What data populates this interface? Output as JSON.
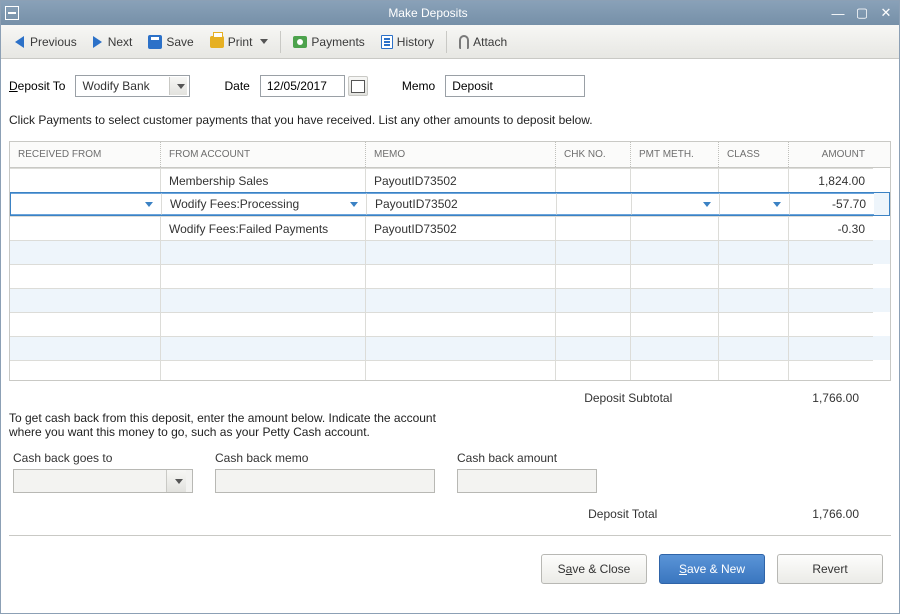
{
  "window": {
    "title": "Make Deposits"
  },
  "toolbar": {
    "previous": "Previous",
    "next": "Next",
    "save": "Save",
    "print": "Print",
    "payments": "Payments",
    "history": "History",
    "attach": "Attach"
  },
  "header": {
    "deposit_to_label": "Deposit To",
    "deposit_to_value": "Wodify Bank",
    "date_label": "Date",
    "date_value": "12/05/2017",
    "memo_label": "Memo",
    "memo_value": "Deposit"
  },
  "instruction": "Click Payments to select customer payments that you have received. List any other amounts to deposit below.",
  "table": {
    "cols": {
      "received_from": "RECEIVED FROM",
      "from_account": "FROM ACCOUNT",
      "memo": "MEMO",
      "chk_no": "CHK NO.",
      "pmt_meth": "PMT METH.",
      "class": "CLASS",
      "amount": "AMOUNT"
    },
    "rows": [
      {
        "received_from": "",
        "from_account": "Membership Sales",
        "memo": "PayoutID73502",
        "chk_no": "",
        "pmt_meth": "",
        "class": "",
        "amount": "1,824.00",
        "active": false
      },
      {
        "received_from": "",
        "from_account": "Wodify Fees:Processing",
        "memo": "PayoutID73502",
        "chk_no": "",
        "pmt_meth": "",
        "class": "",
        "amount": "-57.70",
        "active": true
      },
      {
        "received_from": "",
        "from_account": "Wodify Fees:Failed Payments",
        "memo": "PayoutID73502",
        "chk_no": "",
        "pmt_meth": "",
        "class": "",
        "amount": "-0.30",
        "active": false
      }
    ]
  },
  "subtotal": {
    "label": "Deposit Subtotal",
    "value": "1,766.00"
  },
  "cashback": {
    "note": "To get cash back from this deposit, enter the amount below.  Indicate the account where you want this money to go, such as your Petty Cash account.",
    "goes_to_label": "Cash back goes to",
    "goes_to_value": "",
    "memo_label": "Cash back memo",
    "memo_value": "",
    "amount_label": "Cash back amount",
    "amount_value": ""
  },
  "total": {
    "label": "Deposit Total",
    "value": "1,766.00"
  },
  "footer": {
    "save_close": "Save & Close",
    "save_new": "Save & New",
    "revert": "Revert"
  }
}
